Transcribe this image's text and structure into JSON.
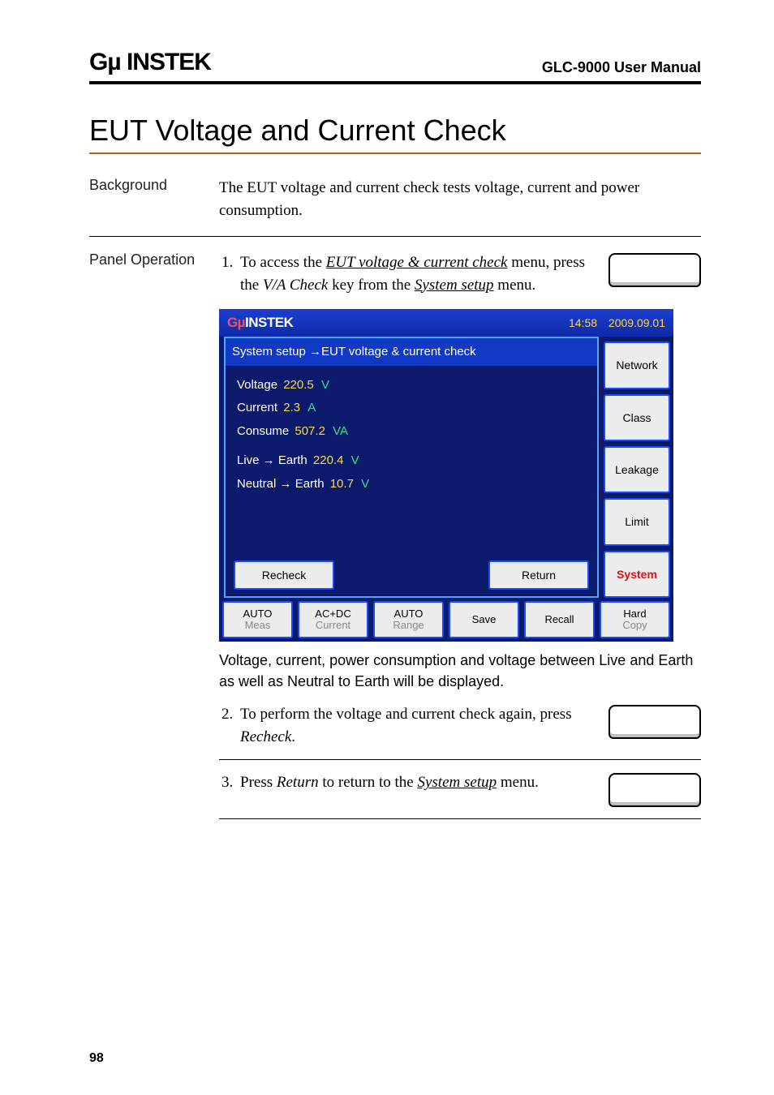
{
  "header": {
    "brand": "Gµ INSTEK",
    "manual": "GLC-9000 User Manual"
  },
  "section_title": "EUT Voltage and Current Check",
  "background": {
    "label": "Background",
    "text": "The EUT voltage and current check tests voltage, current and power consumption."
  },
  "panel": {
    "label": "Panel Operation",
    "step1_prefix": "To access the ",
    "step1_link": "EUT voltage & current check",
    "step1_mid": " menu, press the ",
    "step1_key": "V/A Check",
    "step1_mid2": " key from the ",
    "step1_link2": "System setup",
    "step1_end": " menu.",
    "screenshot": {
      "brand_prefix": "Gµ",
      "brand_rest": "INSTEK",
      "clock": "14:58",
      "date": "2009.09.01",
      "breadcrumb": "System setup →EUT voltage & current check",
      "rows": {
        "voltage_l": "Voltage",
        "voltage_v": "220.5",
        "voltage_u": "V",
        "current_l": "Current",
        "current_v": "2.3",
        "current_u": "A",
        "consume_l": "Consume",
        "consume_v": "507.2",
        "consume_u": "VA",
        "le_l": "Live → Earth",
        "le_v": "220.4",
        "le_u": "V",
        "ne_l": "Neutral → Earth",
        "ne_v": "10.7",
        "ne_u": "V"
      },
      "recheck": "Recheck",
      "return": "Return",
      "side": [
        "Network",
        "Class",
        "Leakage",
        "Limit",
        "System"
      ],
      "bottom": [
        {
          "t": "AUTO",
          "b": "Meas"
        },
        {
          "t": "AC+DC",
          "b": "Current"
        },
        {
          "t": "AUTO",
          "b": "Range"
        },
        {
          "t": "Save",
          "b": ""
        },
        {
          "t": "Recall",
          "b": ""
        },
        {
          "t": "Hard",
          "b": "Copy"
        }
      ]
    },
    "caption": "Voltage, current, power consumption and voltage between Live and Earth as well as Neutral to Earth will be displayed.",
    "step2_prefix": "To perform the voltage and current check again, press ",
    "step2_key": "Recheck",
    "step2_end": ".",
    "step3_prefix": "Press ",
    "step3_key": "Return",
    "step3_mid": " to return to the ",
    "step3_link": "System setup",
    "step3_end": " menu."
  },
  "pgnum": "98"
}
